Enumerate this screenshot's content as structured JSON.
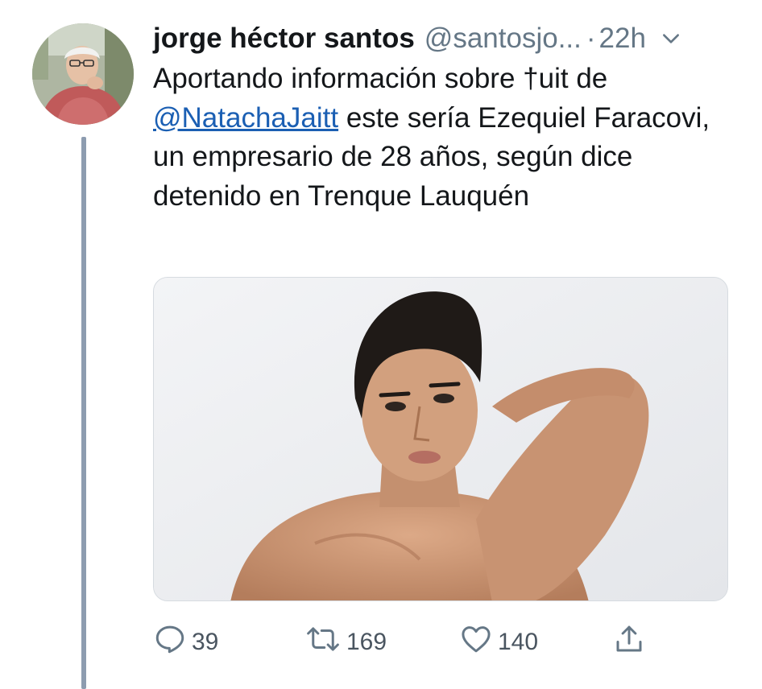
{
  "tweet": {
    "display_name": "jorge héctor santos",
    "handle": "@santosjo...",
    "separator": "·",
    "time": "22h",
    "text_before": "Aportando información sobre ",
    "text_glyph": "†",
    "text_after_glyph": "uit de ",
    "mention": "@NatachaJaitt",
    "text_after": " este sería Ezequiel Faracovi, un empresario de 28 años, según dice detenido en Trenque Lauquén"
  },
  "actions": {
    "replies": "39",
    "retweets": "169",
    "likes": "140"
  },
  "icons": {
    "menu": "chevron-down-icon",
    "reply": "reply-bubble-icon",
    "retweet": "retweet-icon",
    "like": "heart-icon",
    "share": "share-upload-icon"
  },
  "colors": {
    "text": "#14171a",
    "secondary": "#657786",
    "link": "#1b5fb3",
    "thread_line": "#8d9cb0"
  }
}
